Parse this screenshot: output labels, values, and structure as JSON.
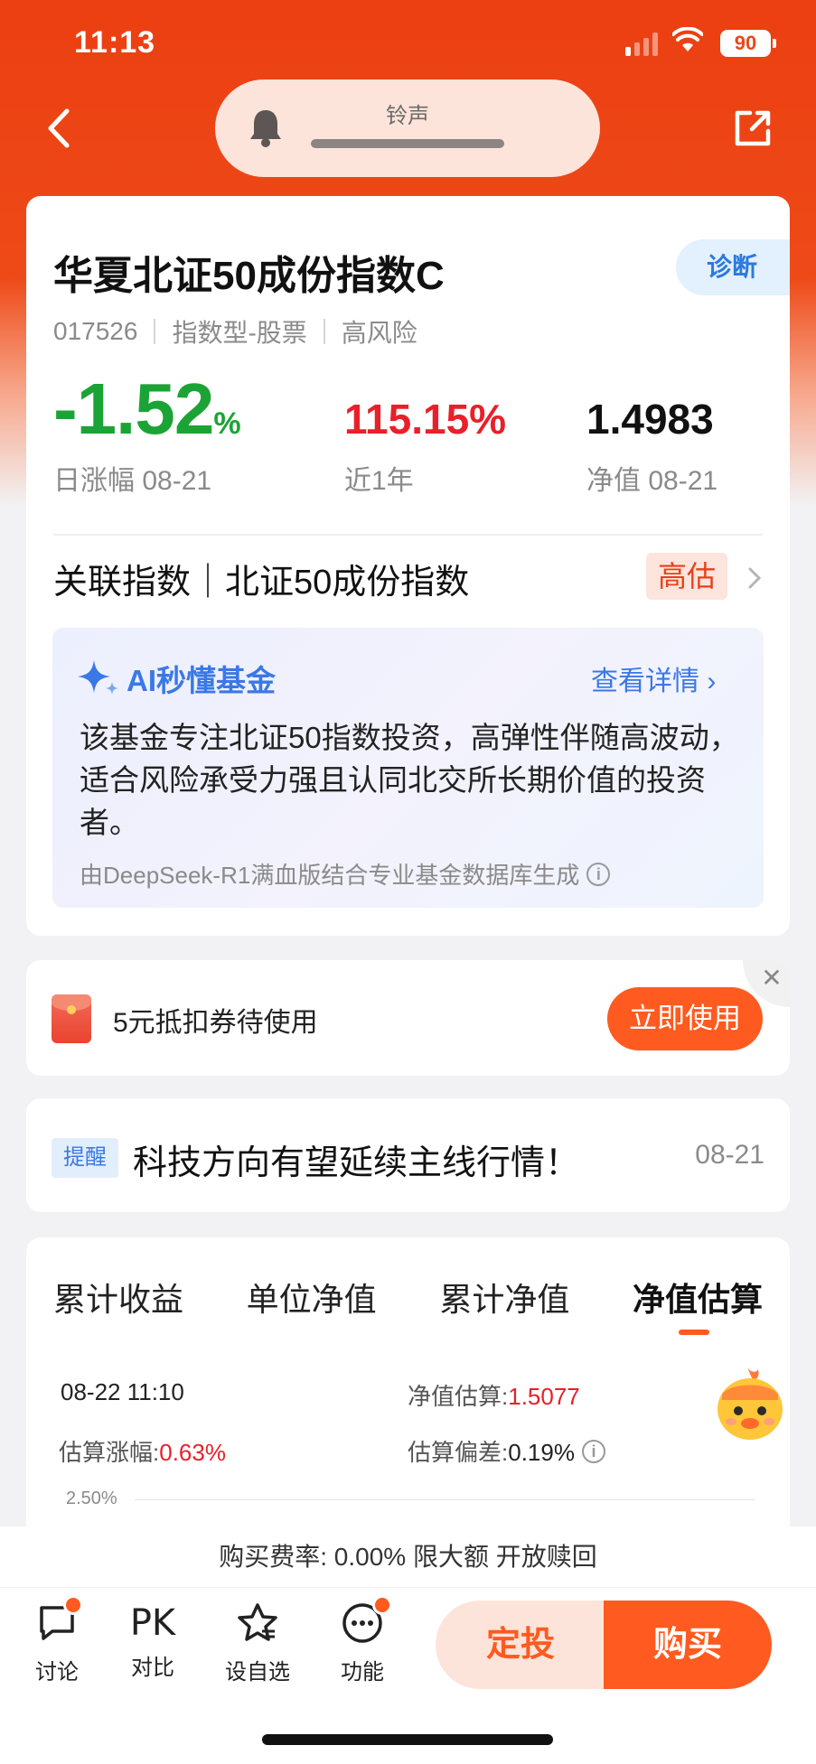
{
  "status": {
    "time": "11:13",
    "battery": "90"
  },
  "header": {
    "ringtone_label": "铃声"
  },
  "fund": {
    "name": "华夏北证50成份指数C",
    "diagnose_label": "诊断",
    "code": "017526",
    "type": "指数型-股票",
    "risk": "高风险",
    "daily_change": "-1.52",
    "daily_change_unit": "%",
    "daily_change_label": "日涨幅 08-21",
    "one_year_return": "115.15%",
    "one_year_label": "近1年",
    "nav": "1.4983",
    "nav_label": "净值 08-21",
    "related_index": "关联指数｜北证50成份指数",
    "valuation_tag": "高估"
  },
  "ai": {
    "title": "AI秒懂基金",
    "more": "查看详情",
    "summary": "该基金专注北证50指数投资，高弹性伴随高波动，适合风险承受力强且认同北交所长期价值的投资者。",
    "footnote": "由DeepSeek-R1满血版结合专业基金数据库生成"
  },
  "coupon": {
    "text": "5元抵扣券待使用",
    "button": "立即使用"
  },
  "reminder": {
    "tag": "提醒",
    "text": "科技方向有望延续主线行情！",
    "date": "08-21"
  },
  "tabs": [
    "累计收益",
    "单位净值",
    "累计净值",
    "净值估算"
  ],
  "estimate": {
    "datetime": "08-22 11:10",
    "est_nav_label": "净值估算:",
    "est_nav_value": "1.5077",
    "est_change_label": "估算涨幅:",
    "est_change_value": "0.63%",
    "est_deviation_label": "估算偏差:",
    "est_deviation_value": "0.19%",
    "y_axis_top": "2.50%"
  },
  "fee_line": "购买费率: 0.00% 限大额 开放赎回",
  "bottom_bar": {
    "discuss": "讨论",
    "pk_icon_text": "PK",
    "compare": "对比",
    "watchlist": "设自选",
    "functions": "功能",
    "sip": "定投",
    "buy": "购买"
  },
  "colors": {
    "brand": "#ff5a1f",
    "down": "#1ca335",
    "up": "#e8202a",
    "link": "#3a78e6"
  }
}
